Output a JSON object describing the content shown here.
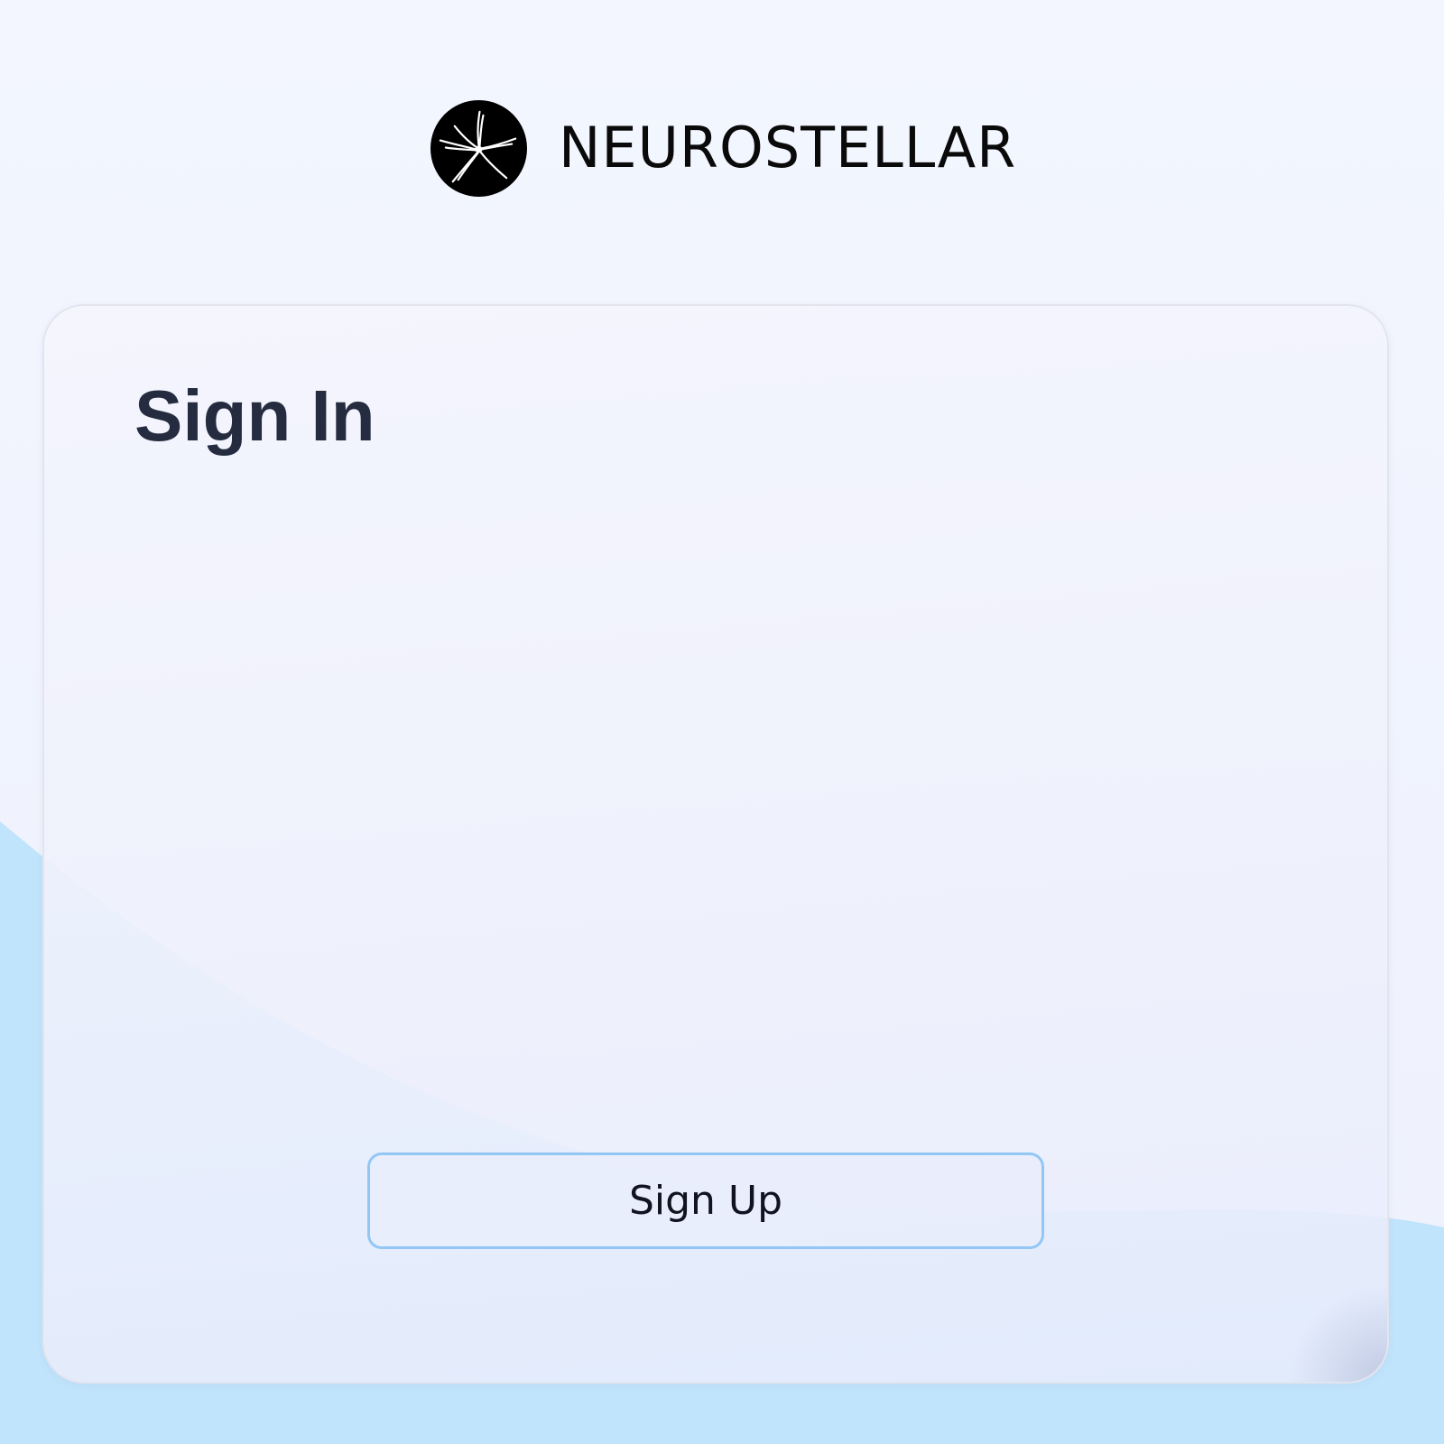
{
  "brand": {
    "name": "NEUROSTELLAR",
    "logo_icon": "neuron-star-logo-icon"
  },
  "card": {
    "title": "Sign In",
    "signup_label": "Sign Up"
  },
  "colors": {
    "background": "#f3f6ff",
    "wave": "#c0e4fc",
    "title": "#262c40",
    "button_border": "#92c7f5"
  }
}
